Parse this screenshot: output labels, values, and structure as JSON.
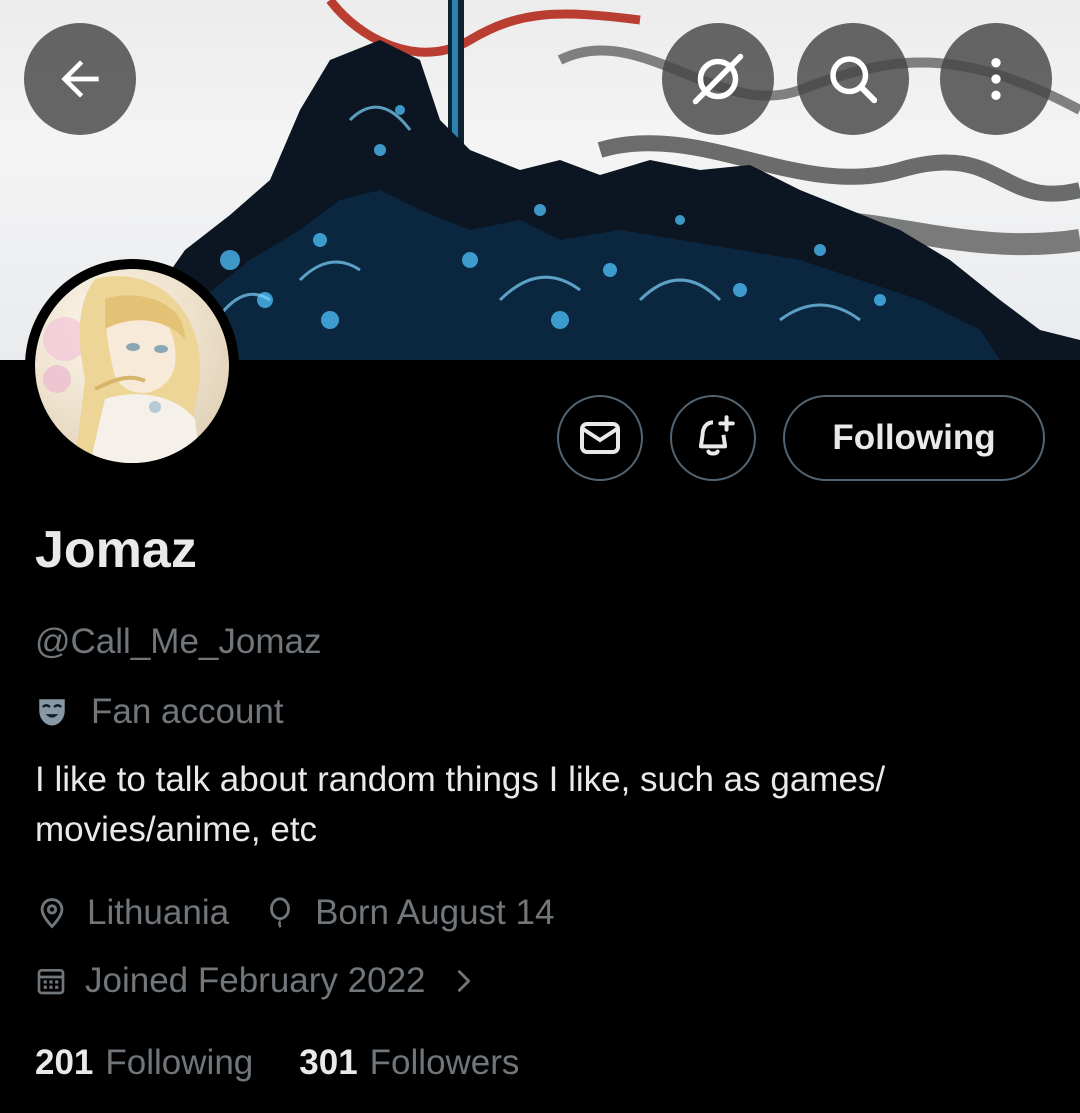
{
  "header": {
    "back_icon": "arrow-left-icon",
    "grok_icon": "grok-icon",
    "search_icon": "search-icon",
    "more_icon": "more-vertical-icon"
  },
  "profile": {
    "display_name": "Jomaz",
    "handle": "@Call_Me_Jomaz",
    "category": "Fan account",
    "bio": "I like to talk about random things I like, such as games/ movies/anime, etc",
    "location": "Lithuania",
    "birthday": "Born August 14",
    "joined": "Joined February 2022"
  },
  "actions": {
    "message_icon": "envelope-icon",
    "notify_icon": "bell-plus-icon",
    "following_label": "Following"
  },
  "stats": {
    "following_count": "201",
    "following_label": "Following",
    "followers_count": "301",
    "followers_label": "Followers"
  },
  "colors": {
    "background": "#000000",
    "text_primary": "#e7e9ea",
    "text_secondary": "#71767b",
    "border": "#536471",
    "banner_accent": "#4fc3ff"
  }
}
